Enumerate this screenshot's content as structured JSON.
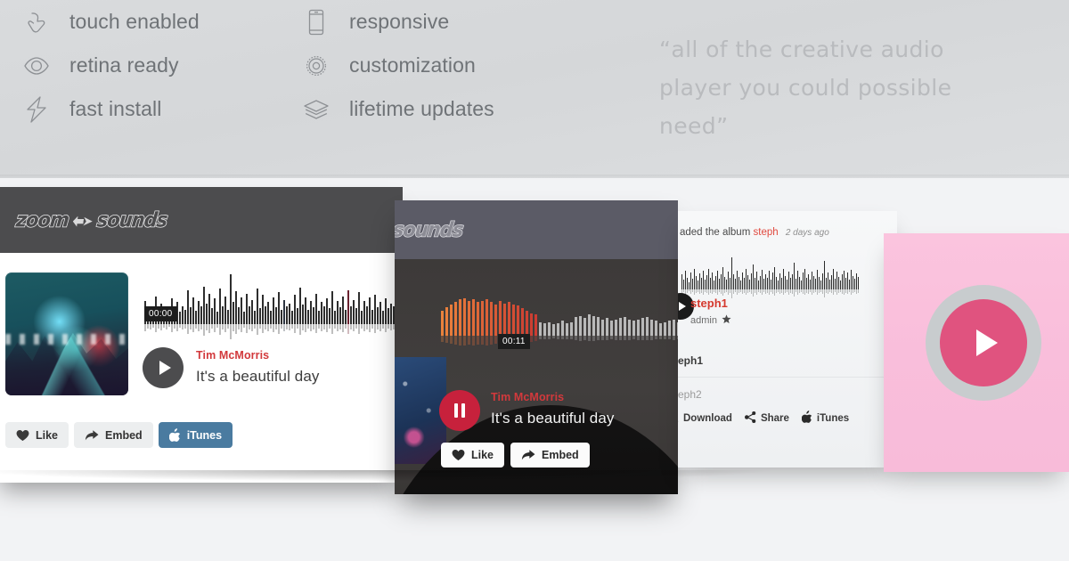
{
  "features": {
    "left": [
      {
        "icon": "hand-touch-icon",
        "label": "touch enabled"
      },
      {
        "icon": "eye-icon",
        "label": "retina ready"
      },
      {
        "icon": "lightning-bolt-icon",
        "label": "fast install"
      }
    ],
    "right": [
      {
        "icon": "mobile-phone-icon",
        "label": "responsive"
      },
      {
        "icon": "gear-icon",
        "label": "customization"
      },
      {
        "icon": "layers-icon",
        "label": "lifetime updates"
      }
    ]
  },
  "quote": {
    "lines": [
      "“all of the creative audio",
      "player you could possible",
      "need”"
    ]
  },
  "brand": {
    "name_part1": "zoom",
    "name_part2": "sounds",
    "accent_red": "#d2393c",
    "itunes_blue": "#4a7ba0",
    "pink": "#e0537f"
  },
  "player_light": {
    "logo_left": "zoom",
    "logo_right": "sounds",
    "time": "00:00",
    "artist": "Tim McMorris",
    "title": "It's a beautiful day",
    "actions": [
      {
        "icon": "heart-icon",
        "label": "Like",
        "style": "light"
      },
      {
        "icon": "share-arrow-icon",
        "label": "Embed",
        "style": "light"
      },
      {
        "icon": "apple-icon",
        "label": "iTunes",
        "style": "itunes"
      }
    ],
    "waveform": [
      38,
      22,
      30,
      18,
      46,
      26,
      34,
      20,
      28,
      16,
      42,
      24,
      36,
      20,
      30,
      24,
      56,
      28,
      44,
      22,
      38,
      30,
      62,
      34,
      50,
      26,
      42,
      20,
      58,
      30,
      46,
      24,
      82,
      36,
      54,
      28,
      44,
      20,
      50,
      30,
      40,
      22,
      58,
      26,
      48,
      30,
      36,
      22,
      44,
      28,
      52,
      24,
      40,
      30,
      34,
      22,
      48,
      26,
      60,
      32,
      44,
      24,
      38,
      28,
      50,
      22,
      36,
      30,
      42,
      26,
      54,
      22,
      38,
      28,
      46,
      24,
      56,
      30,
      40,
      26,
      52,
      22,
      38,
      30,
      44,
      24,
      48,
      28,
      36,
      22,
      42,
      26,
      34,
      30,
      40,
      24,
      32,
      28,
      38,
      22
    ]
  },
  "player_dark": {
    "logo_right": "sounds",
    "time": "00:11",
    "artist": "Tim McMorris",
    "title": "It's a beautiful day",
    "progress_bars": 22,
    "actions": [
      {
        "icon": "heart-icon",
        "label": "Like",
        "style": "white"
      },
      {
        "icon": "share-arrow-icon",
        "label": "Embed",
        "style": "white"
      }
    ],
    "waveform": [
      40,
      46,
      50,
      54,
      58,
      60,
      56,
      58,
      54,
      56,
      58,
      54,
      50,
      56,
      52,
      54,
      50,
      48,
      44,
      40,
      36,
      34,
      22,
      20,
      22,
      18,
      20,
      24,
      20,
      22,
      30,
      32,
      28,
      34,
      32,
      30,
      26,
      28,
      24,
      26,
      28,
      30,
      26,
      24,
      26,
      28,
      30,
      26,
      24,
      20,
      22,
      24,
      26,
      22,
      24,
      28,
      30,
      26,
      28,
      30,
      32,
      28,
      26,
      28,
      30,
      32,
      30,
      28,
      30,
      32,
      34,
      30,
      28,
      26,
      28,
      30,
      28,
      26,
      28,
      30,
      28,
      26,
      24,
      28,
      30,
      32,
      30,
      28
    ]
  },
  "feed_card": {
    "header_text": "aded the album",
    "album": "steph",
    "ago": "2 days ago",
    "track_name": "steph1",
    "uploader": "admin",
    "uploader_badge": "star-icon",
    "playlist": [
      {
        "label": "eph1",
        "active": true
      },
      {
        "label": "eph2",
        "active": false
      }
    ],
    "actions": [
      {
        "icon": "download-icon",
        "label": "Download"
      },
      {
        "icon": "share-nodes-icon",
        "label": "Share"
      },
      {
        "icon": "apple-icon",
        "label": "iTunes"
      }
    ],
    "waveform": [
      16,
      10,
      20,
      12,
      8,
      18,
      11,
      22,
      14,
      9,
      17,
      12,
      20,
      10,
      15,
      22,
      12,
      18,
      9,
      14,
      20,
      11,
      16,
      24,
      13,
      10,
      19,
      12,
      34,
      16,
      11,
      20,
      13,
      9,
      18,
      12,
      22,
      15,
      10,
      17,
      26,
      12,
      19,
      9,
      14,
      21,
      11,
      16,
      12,
      20,
      10,
      18,
      24,
      13,
      9,
      17,
      12,
      22,
      14,
      10,
      19,
      12,
      16,
      28,
      11,
      20,
      13,
      9,
      18,
      22,
      12,
      16,
      10,
      19,
      14,
      11,
      21,
      13,
      9,
      17,
      30,
      12,
      18,
      10,
      15,
      22,
      11,
      19,
      13,
      9,
      16,
      20,
      12,
      18,
      10,
      21,
      14,
      11,
      17,
      13
    ]
  },
  "pink_card": {
    "button": "play-button",
    "ring_color": "#c8ccce",
    "core_color": "#e0537f"
  }
}
